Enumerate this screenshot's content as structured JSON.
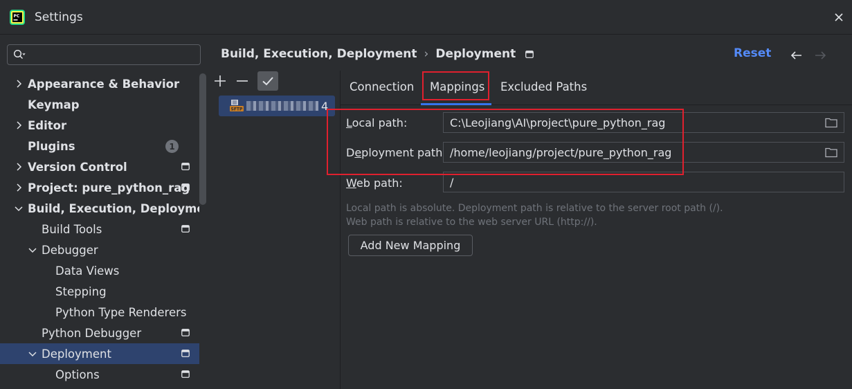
{
  "window": {
    "title": "Settings"
  },
  "search": {
    "placeholder": "",
    "value": ""
  },
  "sidebar": {
    "items": [
      {
        "label": "Appearance & Behavior",
        "level": 0,
        "bold": true,
        "chevron": "right"
      },
      {
        "label": "Keymap",
        "level": 0,
        "bold": true,
        "chevron": "none"
      },
      {
        "label": "Editor",
        "level": 0,
        "bold": true,
        "chevron": "right"
      },
      {
        "label": "Plugins",
        "level": 0,
        "bold": true,
        "chevron": "none",
        "badge": "1"
      },
      {
        "label": "Version Control",
        "level": 0,
        "bold": true,
        "chevron": "right",
        "project_icon": true
      },
      {
        "label": "Project: pure_python_rag",
        "level": 0,
        "bold": true,
        "chevron": "right",
        "project_icon": true
      },
      {
        "label": "Build, Execution, Deployme",
        "level": 0,
        "bold": true,
        "chevron": "down"
      },
      {
        "label": "Build Tools",
        "level": 1,
        "bold": false,
        "chevron": "none",
        "project_icon": true
      },
      {
        "label": "Debugger",
        "level": 1,
        "bold": false,
        "chevron": "down"
      },
      {
        "label": "Data Views",
        "level": 2,
        "bold": false,
        "chevron": "none"
      },
      {
        "label": "Stepping",
        "level": 2,
        "bold": false,
        "chevron": "none"
      },
      {
        "label": "Python Type Renderers",
        "level": 2,
        "bold": false,
        "chevron": "none"
      },
      {
        "label": "Python Debugger",
        "level": 1,
        "bold": false,
        "chevron": "none",
        "project_icon": true
      },
      {
        "label": "Deployment",
        "level": 1,
        "bold": false,
        "chevron": "down",
        "project_icon": true,
        "selected": true
      },
      {
        "label": "Options",
        "level": 2,
        "bold": false,
        "chevron": "none",
        "project_icon": true
      }
    ]
  },
  "breadcrumb": {
    "parent": "Build, Execution, Deployment",
    "separator": "›",
    "current": "Deployment"
  },
  "header": {
    "reset_label": "Reset"
  },
  "servers": {
    "items": [
      {
        "type_icon": "sftp-icon",
        "name_suffix": "4"
      }
    ]
  },
  "tabs": [
    {
      "label": "Connection",
      "active": false
    },
    {
      "label": "Mappings",
      "active": true
    },
    {
      "label": "Excluded Paths",
      "active": false
    }
  ],
  "mappings": {
    "local_path_label_mnemonic": "L",
    "local_path_label_rest": "ocal path:",
    "local_path_value": "C:\\Leojiang\\AI\\project\\pure_python_rag",
    "deployment_path_label_pre": "D",
    "deployment_path_label_mnemonic": "e",
    "deployment_path_label_rest": "ployment path:",
    "deployment_path_value": "/home/leojiang/project/pure_python_rag",
    "web_path_label_mnemonic": "W",
    "web_path_label_rest": "eb path:",
    "web_path_value": "/",
    "hint_line1": "Local path is absolute. Deployment path is relative to the server root path (/).",
    "hint_line2": "Web path is relative to the web server URL (http://).",
    "add_button_label": "Add New Mapping"
  },
  "colors": {
    "accent": "#3574f0",
    "link": "#548af7",
    "highlight": "#e0202e",
    "selection": "#2e436e"
  }
}
